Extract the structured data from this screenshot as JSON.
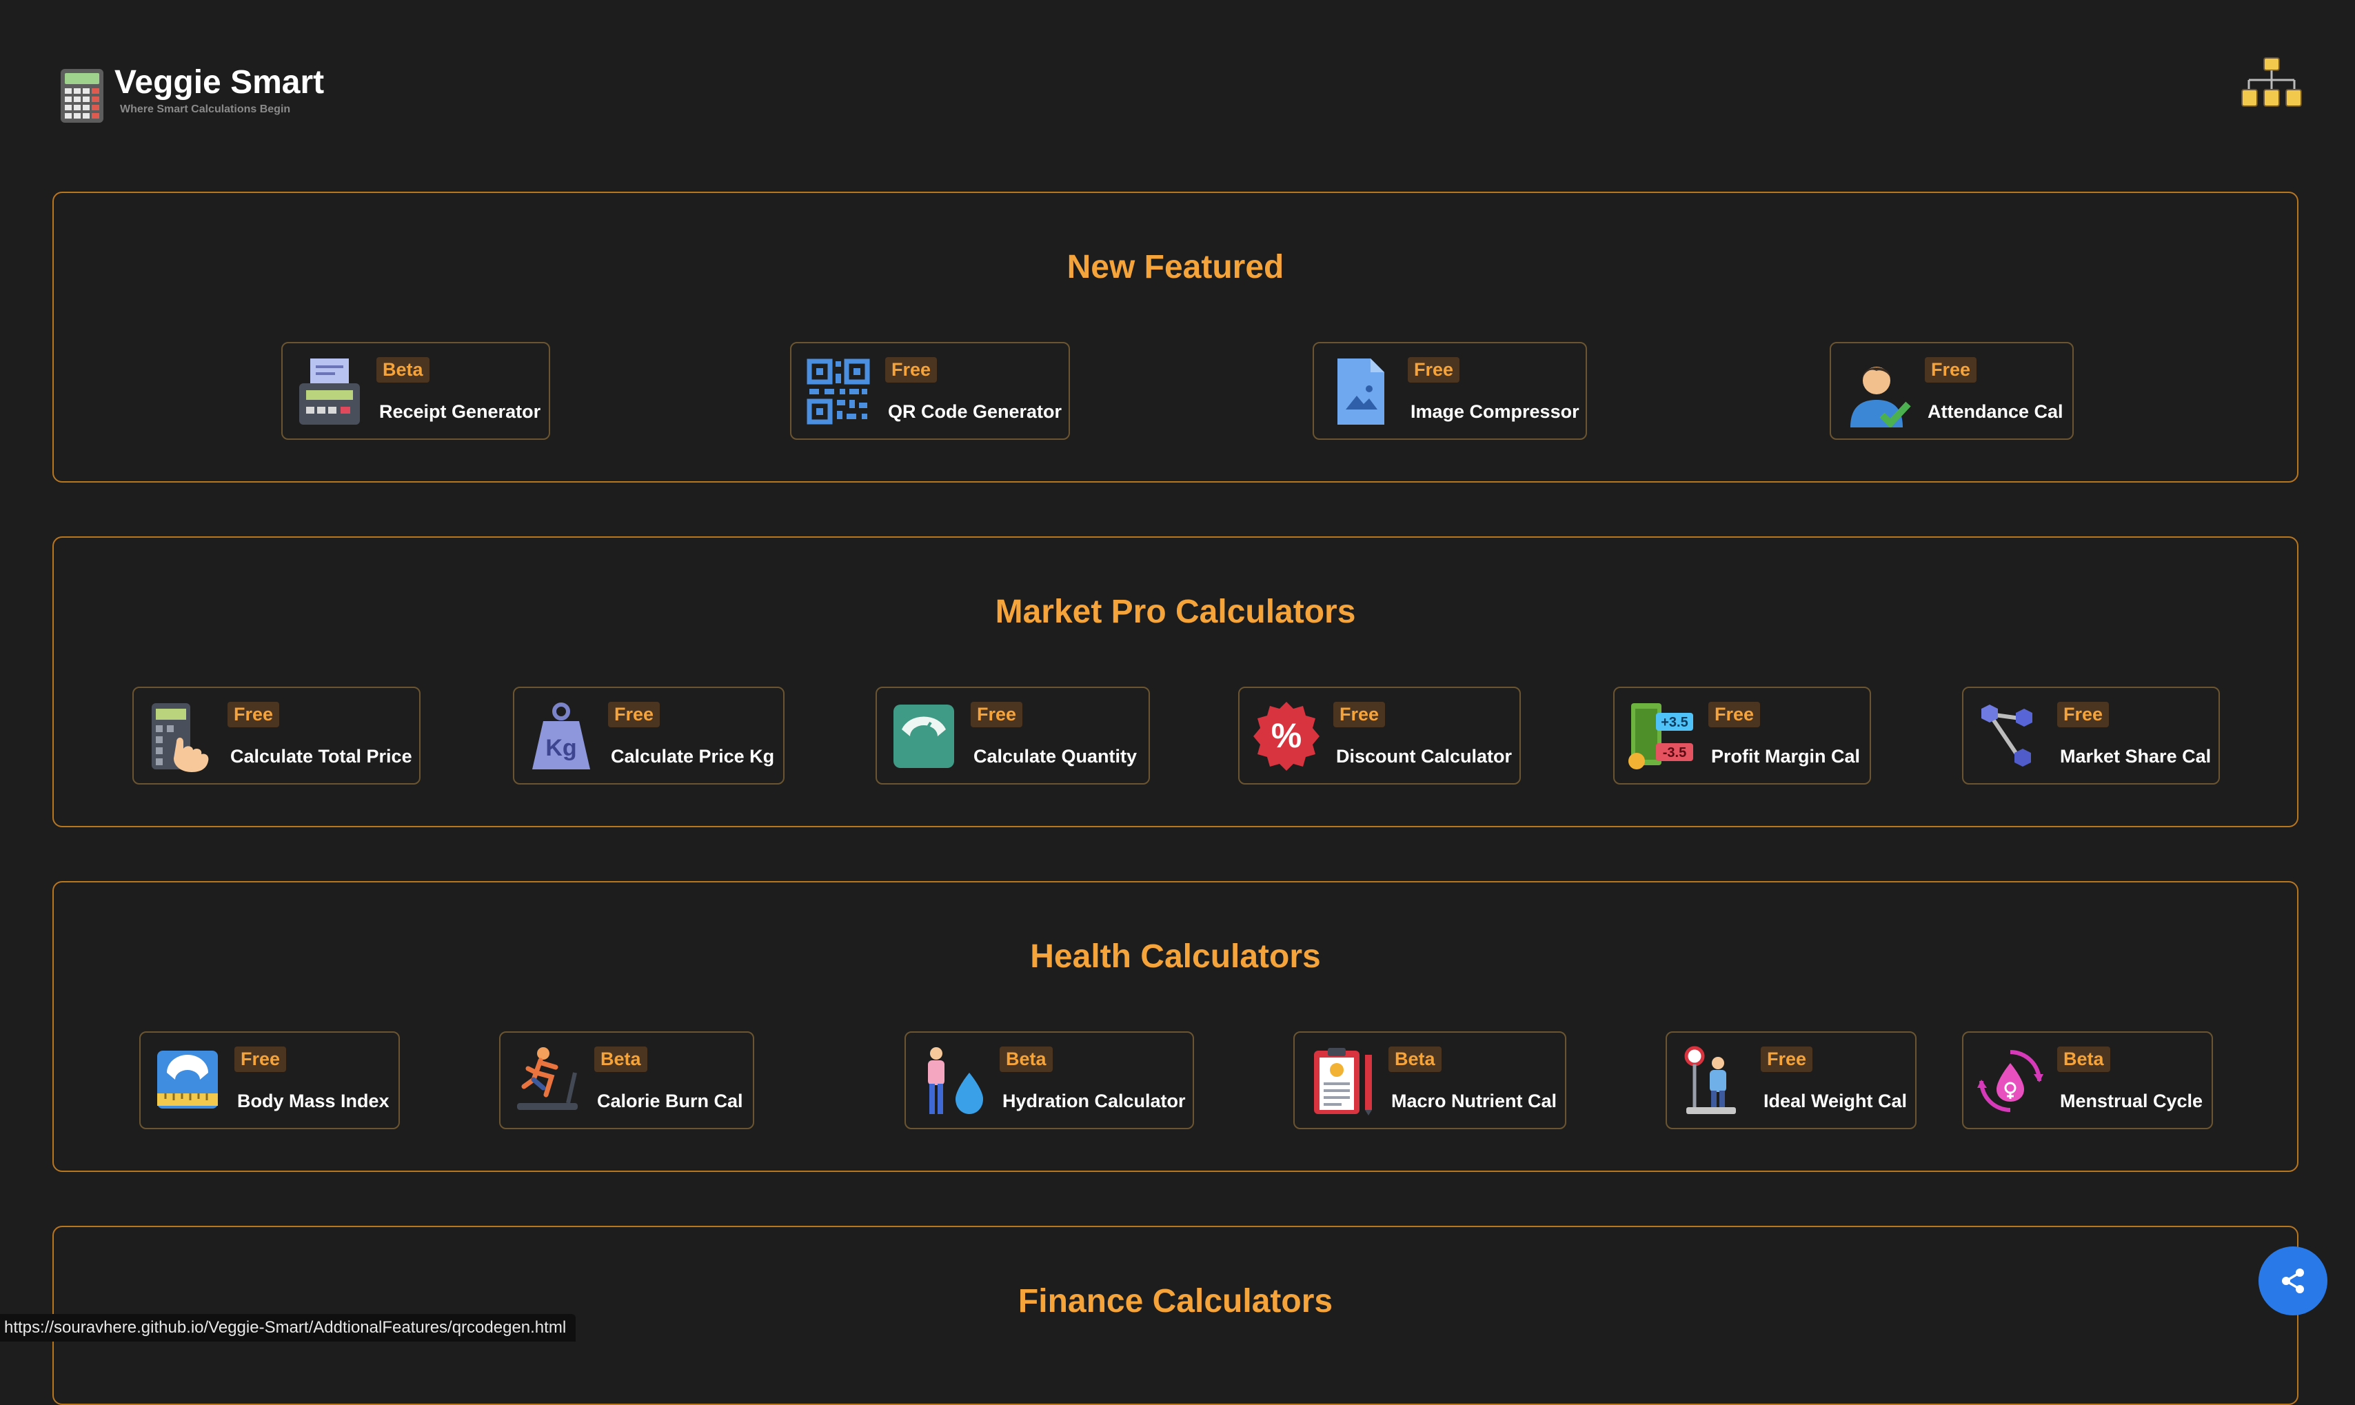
{
  "brand": {
    "title": "Veggie Smart",
    "tagline": "Where Smart Calculations Begin"
  },
  "sections": [
    {
      "title": "New Featured",
      "cards": [
        {
          "badge": "Beta",
          "label": "Receipt Generator",
          "icon": "receipt-printer-icon"
        },
        {
          "badge": "Free",
          "label": "QR Code Generator",
          "icon": "qr-code-icon"
        },
        {
          "badge": "Free",
          "label": "Image Compressor",
          "icon": "image-file-icon"
        },
        {
          "badge": "Free",
          "label": "Attendance Cal",
          "icon": "person-check-icon"
        }
      ]
    },
    {
      "title": "Market Pro Calculators",
      "cards": [
        {
          "badge": "Free",
          "label": "Calculate Total Price",
          "icon": "calculator-hand-icon"
        },
        {
          "badge": "Free",
          "label": "Calculate Price Kg",
          "icon": "kg-weight-icon"
        },
        {
          "badge": "Free",
          "label": "Calculate Quantity",
          "icon": "weighing-scale-icon"
        },
        {
          "badge": "Free",
          "label": "Discount Calculator",
          "icon": "percent-badge-icon"
        },
        {
          "badge": "Free",
          "label": "Profit Margin Cal",
          "icon": "money-margin-icon"
        },
        {
          "badge": "Free",
          "label": "Market Share Cal",
          "icon": "share-nodes-icon"
        }
      ]
    },
    {
      "title": "Health Calculators",
      "cards": [
        {
          "badge": "Free",
          "label": "Body Mass Index",
          "icon": "bmi-scale-icon"
        },
        {
          "badge": "Beta",
          "label": "Calorie Burn Cal",
          "icon": "treadmill-runner-icon"
        },
        {
          "badge": "Beta",
          "label": "Hydration Calculator",
          "icon": "water-drop-person-icon"
        },
        {
          "badge": "Beta",
          "label": "Macro Nutrient Cal",
          "icon": "nutrition-clipboard-icon"
        },
        {
          "badge": "Free",
          "label": "Ideal Weight Cal",
          "icon": "ideal-weight-icon"
        },
        {
          "badge": "Beta",
          "label": "Menstrual Cycle",
          "icon": "cycle-drop-icon"
        }
      ]
    },
    {
      "title": "Finance Calculators",
      "cards": []
    }
  ],
  "status_url": "https://souravhere.github.io/Veggie-Smart/AddtionalFeatures/qrcodegen.html",
  "colors": {
    "background": "#1d1d1d",
    "accent": "#f5a33b",
    "section_border": "#b8761f",
    "badge_bg": "#4b3520",
    "fab": "#2979e8"
  }
}
